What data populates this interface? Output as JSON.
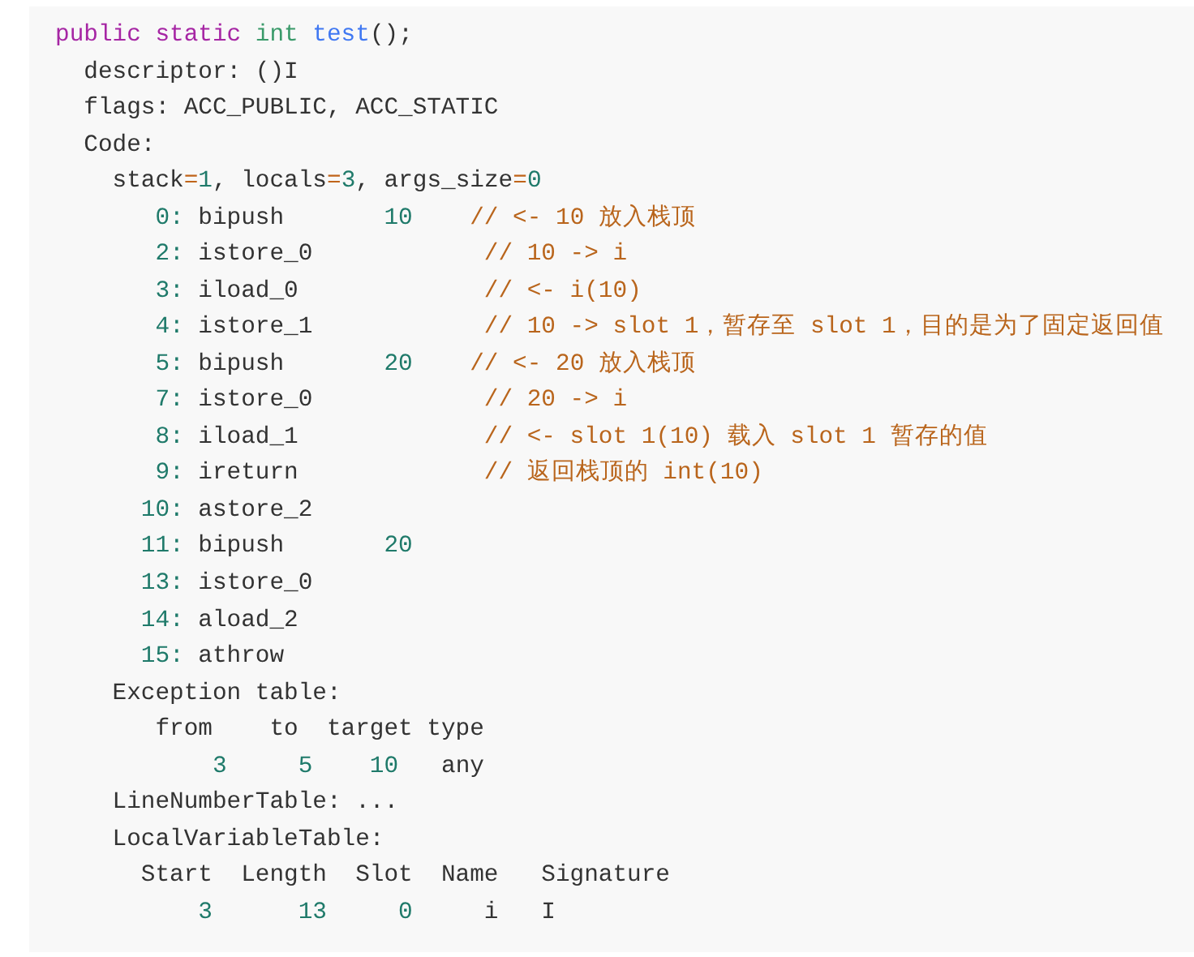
{
  "code_block": {
    "lines": [
      {
        "kind": "method",
        "tokens": [
          {
            "kind": "kw",
            "text": "public static "
          },
          {
            "kind": "type",
            "text": "int "
          },
          {
            "kind": "fn",
            "text": "test"
          },
          {
            "kind": "tx",
            "text": "();"
          }
        ]
      },
      {
        "kind": "attribute",
        "tokens": [
          {
            "kind": "tx",
            "text": "descriptor: ()I"
          }
        ]
      },
      {
        "kind": "attribute",
        "tokens": [
          {
            "kind": "tx",
            "text": "flags: ACC_PUBLIC, ACC_STATIC"
          }
        ]
      },
      {
        "kind": "attribute",
        "tokens": [
          {
            "kind": "tx",
            "text": "Code:"
          }
        ]
      },
      {
        "kind": "section",
        "tokens": [
          {
            "kind": "tx",
            "text": "stack"
          },
          {
            "kind": "op",
            "text": "="
          },
          {
            "kind": "num",
            "text": "1"
          },
          {
            "kind": "tx",
            "text": ", locals"
          },
          {
            "kind": "op",
            "text": "="
          },
          {
            "kind": "num",
            "text": "3"
          },
          {
            "kind": "tx",
            "text": ", args_size"
          },
          {
            "kind": "op",
            "text": "="
          },
          {
            "kind": "num",
            "text": "0"
          }
        ]
      },
      {
        "kind": "instruction",
        "tokens": [
          {
            "kind": "num",
            "text": "0:"
          },
          {
            "kind": "tx",
            "text": " bipush"
          },
          {
            "kind": "num",
            "text": "       10"
          },
          {
            "kind": "cm",
            "text": "    // <- 10 放入栈顶"
          }
        ]
      },
      {
        "kind": "instruction",
        "tokens": [
          {
            "kind": "num",
            "text": "2:"
          },
          {
            "kind": "tx",
            "text": " istore_0"
          },
          {
            "kind": "cm",
            "text": "            // 10 -> i"
          }
        ]
      },
      {
        "kind": "instruction",
        "tokens": [
          {
            "kind": "num",
            "text": "3:"
          },
          {
            "kind": "tx",
            "text": " iload_0"
          },
          {
            "kind": "cm",
            "text": "             // <- i(10)"
          }
        ]
      },
      {
        "kind": "instruction",
        "tokens": [
          {
            "kind": "num",
            "text": "4:"
          },
          {
            "kind": "tx",
            "text": " istore_1"
          },
          {
            "kind": "cm",
            "text": "            // 10 -> slot 1，暂存至 slot 1，目的是为了固定返回值"
          }
        ]
      },
      {
        "kind": "instruction",
        "tokens": [
          {
            "kind": "num",
            "text": "5:"
          },
          {
            "kind": "tx",
            "text": " bipush"
          },
          {
            "kind": "num",
            "text": "       20"
          },
          {
            "kind": "cm",
            "text": "    // <- 20 放入栈顶"
          }
        ]
      },
      {
        "kind": "instruction",
        "tokens": [
          {
            "kind": "num",
            "text": "7:"
          },
          {
            "kind": "tx",
            "text": " istore_0"
          },
          {
            "kind": "cm",
            "text": "            // 20 -> i"
          }
        ]
      },
      {
        "kind": "instruction",
        "tokens": [
          {
            "kind": "num",
            "text": "8:"
          },
          {
            "kind": "tx",
            "text": " iload_1"
          },
          {
            "kind": "cm",
            "text": "             // <- slot 1(10) 载入 slot 1 暂存的值"
          }
        ]
      },
      {
        "kind": "instruction",
        "tokens": [
          {
            "kind": "num",
            "text": "9:"
          },
          {
            "kind": "tx",
            "text": " ireturn"
          },
          {
            "kind": "cm",
            "text": "             // 返回栈顶的 int(10)"
          }
        ]
      },
      {
        "kind": "instruction_wide",
        "tokens": [
          {
            "kind": "num",
            "text": "10:"
          },
          {
            "kind": "tx",
            "text": " astore_2"
          }
        ]
      },
      {
        "kind": "instruction_wide",
        "tokens": [
          {
            "kind": "num",
            "text": "11:"
          },
          {
            "kind": "tx",
            "text": " bipush"
          },
          {
            "kind": "num",
            "text": "       20"
          }
        ]
      },
      {
        "kind": "instruction_wide",
        "tokens": [
          {
            "kind": "num",
            "text": "13:"
          },
          {
            "kind": "tx",
            "text": " istore_0"
          }
        ]
      },
      {
        "kind": "instruction_wide",
        "tokens": [
          {
            "kind": "num",
            "text": "14:"
          },
          {
            "kind": "tx",
            "text": " aload_2"
          }
        ]
      },
      {
        "kind": "instruction_wide",
        "tokens": [
          {
            "kind": "num",
            "text": "15:"
          },
          {
            "kind": "tx",
            "text": " athrow"
          }
        ]
      },
      {
        "kind": "section",
        "tokens": [
          {
            "kind": "tx",
            "text": "Exception table:"
          }
        ]
      },
      {
        "kind": "exception_header",
        "tokens": [
          {
            "kind": "tx",
            "text": "from    to  target type"
          }
        ]
      },
      {
        "kind": "exception_row",
        "tokens": [
          {
            "kind": "num",
            "text": "3"
          },
          {
            "kind": "num",
            "text": "     5"
          },
          {
            "kind": "num",
            "text": "    10"
          },
          {
            "kind": "tx",
            "text": "   any"
          }
        ]
      },
      {
        "kind": "section",
        "tokens": [
          {
            "kind": "tx",
            "text": "LineNumberTable: ..."
          }
        ]
      },
      {
        "kind": "section",
        "tokens": [
          {
            "kind": "tx",
            "text": "LocalVariableTable:"
          }
        ]
      },
      {
        "kind": "variable_header",
        "tokens": [
          {
            "kind": "tx",
            "text": "Start  Length  Slot  Name   Signature"
          }
        ]
      },
      {
        "kind": "variable_row",
        "tokens": [
          {
            "kind": "num",
            "text": "3"
          },
          {
            "kind": "num",
            "text": "      13"
          },
          {
            "kind": "num",
            "text": "     0"
          },
          {
            "kind": "tx",
            "text": "     i   I"
          }
        ]
      }
    ]
  }
}
